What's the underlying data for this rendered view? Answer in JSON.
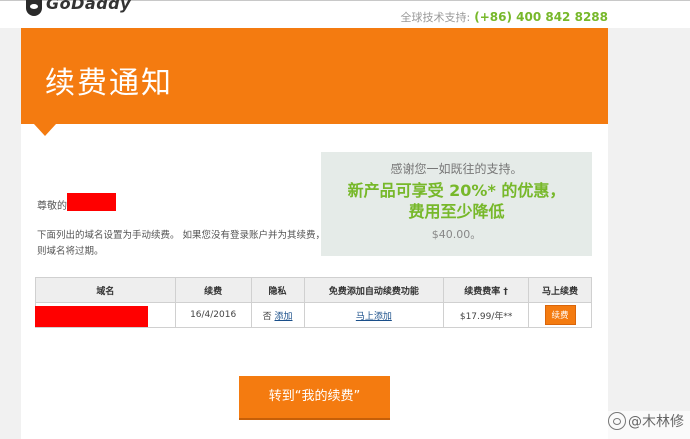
{
  "header": {
    "logo_text": "GoDaddy",
    "support_label": "全球技术支持:",
    "support_phone": "(+86) 400 842 8288"
  },
  "banner": {
    "title": "续费通知"
  },
  "promo": {
    "thanks": "感谢您一如既往的支持。",
    "offer_line1": "新产品可享受 20%* 的优惠，",
    "offer_line2": "费用至少降低",
    "price": "$40.00。"
  },
  "greeting": "尊敬的",
  "intro": "下面列出的域名设置为手动续费。 如果您没有登录账户并为其续费，则域名将过期。",
  "table": {
    "headers": [
      "域名",
      "续费",
      "隐私",
      "免费添加自动续费功能",
      "续费费率 †",
      "马上续费"
    ],
    "rows": [
      {
        "domain": "",
        "renew_date": "16/4/2016",
        "privacy_prefix": "否",
        "privacy_link": "添加",
        "auto_renew_link": "马上添加",
        "rate": "$17.99/年**",
        "action": "续费"
      }
    ]
  },
  "cta": {
    "label": "转到“我的续费”"
  },
  "watermark": "@木林修",
  "colors": {
    "brand_orange": "#f47b10",
    "accent_green": "#77b82a",
    "alert_red": "#e0393e"
  }
}
